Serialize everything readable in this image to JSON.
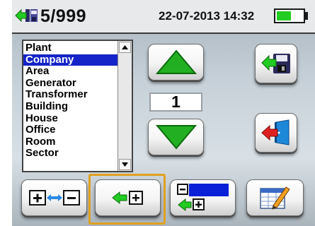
{
  "header": {
    "record_icon": "record-list-icon",
    "counter": "5/999",
    "datetime": "22-07-2013 14:32",
    "battery_level": 0.6,
    "battery_color": "#22cc22"
  },
  "structure_list": {
    "items": [
      "Plant",
      "Company",
      "Area",
      "Generator",
      "Transformer",
      "Building",
      "House",
      "Office",
      "Room",
      "Sector"
    ],
    "selected_index": 1,
    "selected_color": "#1424c8"
  },
  "level": {
    "value": "1",
    "up_icon": "triangle-up-icon",
    "down_icon": "triangle-down-icon",
    "arrow_color": "#22b022"
  },
  "actions": {
    "save_icon": "save-to-disk-icon",
    "exit_icon": "exit-door-icon",
    "expand_collapse_icon": "expand-collapse-icon",
    "add_node_icon": "add-node-icon",
    "add_subnode_icon": "add-subnode-icon",
    "edit_icon": "edit-pencil-icon",
    "selected_button_border": "#e0a020"
  }
}
